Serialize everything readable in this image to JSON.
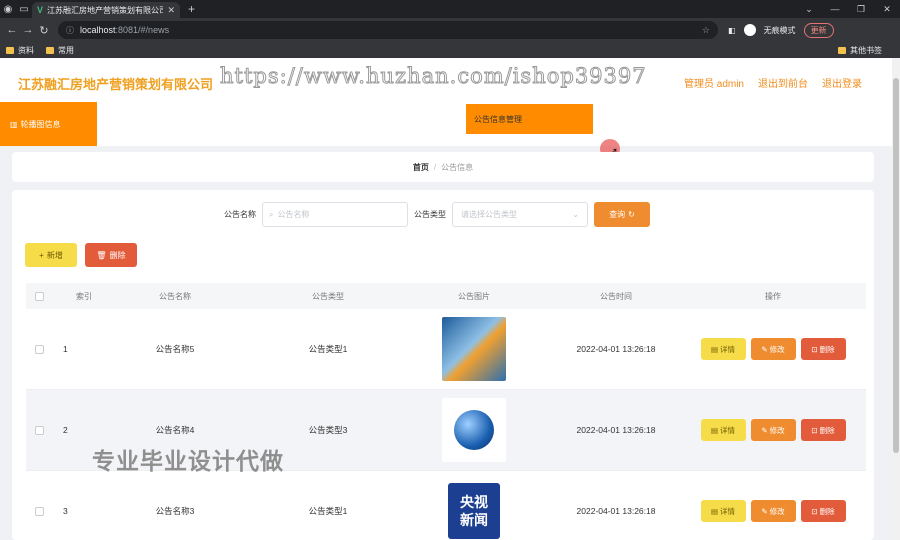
{
  "browser": {
    "tab_title": "江苏融汇房地产营销策划有限公司",
    "url_host": "localhost",
    "url_path": ":8081/#/news",
    "incognito_label": "无痕模式",
    "update_label": "更新",
    "bookmarks": [
      "资料",
      "常用"
    ],
    "other_bookmarks": "其他书签"
  },
  "header": {
    "brand": "江苏融汇房地产营销策划有限公司",
    "watermark": "https://www.huzhan.com/ishop39397",
    "user": "管理员 admin",
    "back_front": "退出到前台",
    "logout": "退出登录"
  },
  "menu": {
    "side_item": "轮播图信息",
    "active_item": "公告信息管理"
  },
  "breadcrumb": {
    "home": "首页",
    "sep": "/",
    "current": "公告信息"
  },
  "search": {
    "name_label": "公告名称",
    "name_placeholder": "公告名称",
    "type_label": "公告类型",
    "type_placeholder": "请选择公告类型",
    "query_label": "查询"
  },
  "actions": {
    "add_label": "新增",
    "delete_label": "删除"
  },
  "table": {
    "headers": {
      "index": "索引",
      "name": "公告名称",
      "type": "公告类型",
      "image": "公告图片",
      "time": "公告时间",
      "ops": "操作"
    },
    "rows": [
      {
        "index": "1",
        "name": "公告名称5",
        "type": "公告类型1",
        "image": "news-banner",
        "time": "2022-04-01 13:26:18"
      },
      {
        "index": "2",
        "name": "公告名称4",
        "type": "公告类型3",
        "image": "globe",
        "time": "2022-04-01 13:26:18"
      },
      {
        "index": "3",
        "name": "公告名称3",
        "type": "公告类型1",
        "image": "cctv-news",
        "time": "2022-04-01 13:26:18"
      }
    ],
    "op_labels": {
      "detail": "详情",
      "edit": "修改",
      "del": "删除"
    }
  },
  "thumb_text": {
    "cctv_line1": "央视",
    "cctv_line2": "新闻"
  },
  "overlay_watermark": "专业毕业设计代做",
  "colors": {
    "accent": "#ff8c00",
    "brand": "#f0a020",
    "warning": "#f7dc4a",
    "danger": "#e25c3c"
  }
}
